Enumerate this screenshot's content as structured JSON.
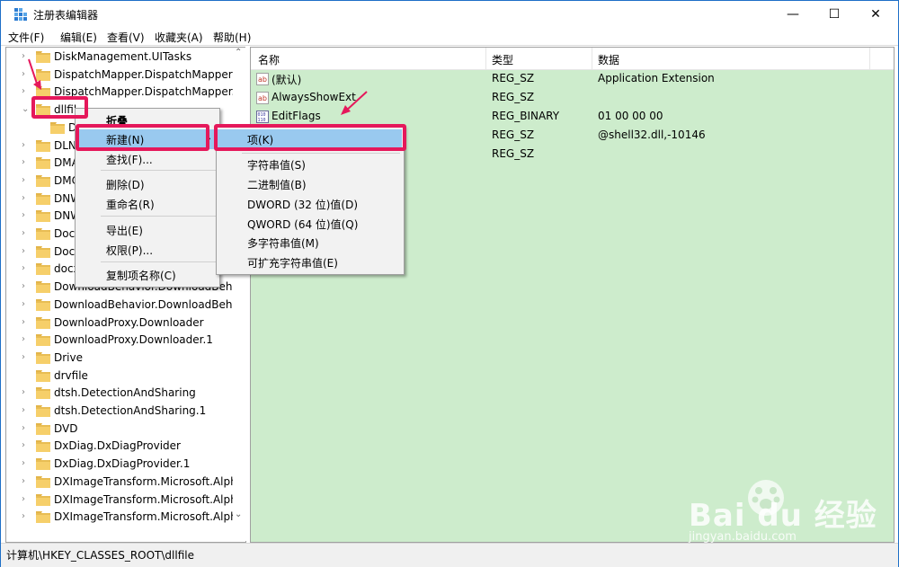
{
  "window": {
    "title": "注册表编辑器",
    "controls": {
      "minimize": "—",
      "maximize": "☐",
      "close": "✕"
    }
  },
  "menubar": [
    "文件(F)",
    "编辑(E)",
    "查看(V)",
    "收藏夹(A)",
    "帮助(H)"
  ],
  "tree": [
    {
      "label": "DiskManagement.UITasks",
      "chevron": "›"
    },
    {
      "label": "DispatchMapper.DispatchMapper",
      "chevron": "›"
    },
    {
      "label": "DispatchMapper.DispatchMapper.",
      "chevron": "›"
    },
    {
      "label": "dllfil",
      "chevron": "⌄"
    },
    {
      "label": "D",
      "chevron": ""
    },
    {
      "label": "DLN",
      "chevron": "›"
    },
    {
      "label": "DMA",
      "chevron": "›"
    },
    {
      "label": "DMC",
      "chevron": "›"
    },
    {
      "label": "DNW",
      "chevron": "›"
    },
    {
      "label": "DNW",
      "chevron": "›"
    },
    {
      "label": "Doc\\",
      "chevron": "›"
    },
    {
      "label": "Doc\\",
      "chevron": "›"
    },
    {
      "label": "docx",
      "chevron": "›"
    },
    {
      "label": "DownloadBehavior.DownloadBeha",
      "chevron": "›"
    },
    {
      "label": "DownloadBehavior.DownloadBeha",
      "chevron": "›"
    },
    {
      "label": "DownloadProxy.Downloader",
      "chevron": "›"
    },
    {
      "label": "DownloadProxy.Downloader.1",
      "chevron": "›"
    },
    {
      "label": "Drive",
      "chevron": "›"
    },
    {
      "label": "drvfile",
      "chevron": ""
    },
    {
      "label": "dtsh.DetectionAndSharing",
      "chevron": "›"
    },
    {
      "label": "dtsh.DetectionAndSharing.1",
      "chevron": "›"
    },
    {
      "label": "DVD",
      "chevron": "›"
    },
    {
      "label": "DxDiag.DxDiagProvider",
      "chevron": "›"
    },
    {
      "label": "DxDiag.DxDiagProvider.1",
      "chevron": "›"
    },
    {
      "label": "DXImageTransform.Microsoft.Alph",
      "chevron": "›"
    },
    {
      "label": "DXImageTransform.Microsoft.Alph",
      "chevron": "›"
    },
    {
      "label": "DXImageTransform.Microsoft.Alph",
      "chevron": "›"
    }
  ],
  "columns": {
    "name": "名称",
    "type": "类型",
    "data": "数据"
  },
  "values": [
    {
      "name": "(默认)",
      "type": "REG_SZ",
      "data": "Application Extension",
      "icon": "string-value-icon"
    },
    {
      "name": "AlwaysShowExt",
      "type": "REG_SZ",
      "data": "",
      "icon": "string-value-icon"
    },
    {
      "name": "EditFlags",
      "type": "REG_BINARY",
      "data": "01 00 00 00",
      "icon": "binary-value-icon"
    },
    {
      "name": "",
      "type": "REG_SZ",
      "data": "@shell32.dll,-10146",
      "icon": ""
    },
    {
      "name": "",
      "type": "REG_SZ",
      "data": "",
      "icon": ""
    }
  ],
  "context_menu": {
    "items": [
      "折叠",
      "新建(N)",
      "查找(F)...",
      "删除(D)",
      "重命名(R)",
      "导出(E)",
      "权限(P)...",
      "复制项名称(C)"
    ],
    "submenu_arrow": "›"
  },
  "new_submenu": {
    "items": [
      "项(K)",
      "字符串值(S)",
      "二进制值(B)",
      "DWORD (32 位)值(D)",
      "QWORD (64 位)值(Q)",
      "多字符串值(M)",
      "可扩充字符串值(E)"
    ]
  },
  "statusbar": {
    "path": "计算机\\HKEY_CLASSES_ROOT\\dllfile"
  },
  "watermark": {
    "brand": "Bai du 经验",
    "url": "jingyan.baidu.com"
  },
  "colors": {
    "list_bg": "#cdeccc",
    "highlight": "#99c9ef",
    "annotation": "#e5185b",
    "title_accent": "#0c66c2"
  }
}
